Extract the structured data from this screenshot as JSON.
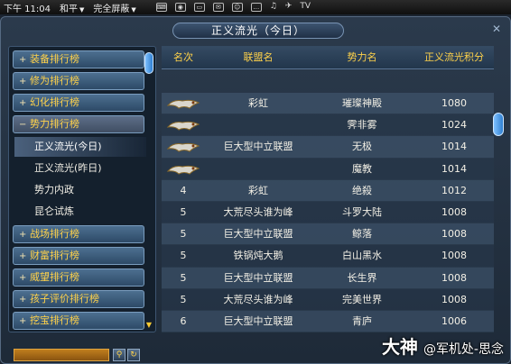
{
  "statusbar": {
    "time": "下午 11:04",
    "status": "和平",
    "display_mode": "完全屏蔽",
    "icons": [
      "keyboard-icon",
      "camera-icon",
      "monitor-icon",
      "mail-icon",
      "friends-icon",
      "chat-icon",
      "audio-icon",
      "bird-icon",
      "tv-icon"
    ],
    "tv_label": "TV"
  },
  "window": {
    "title": "正义流光（今日）"
  },
  "left_panel": {
    "categories_top": [
      {
        "label": "装备排行榜",
        "sign": "+"
      },
      {
        "label": "修为排行榜",
        "sign": "+"
      },
      {
        "label": "幻化排行榜",
        "sign": "+"
      },
      {
        "label": "势力排行榜",
        "sign": "−"
      }
    ],
    "subitems": [
      "正义流光(今日)",
      "正义流光(昨日)",
      "势力内政",
      "昆仑试炼"
    ],
    "categories_bottom": [
      {
        "label": "战场排行榜",
        "sign": "+"
      },
      {
        "label": "财富排行榜",
        "sign": "+"
      },
      {
        "label": "威望排行榜",
        "sign": "+"
      },
      {
        "label": "孩子评价排行榜",
        "sign": "+"
      },
      {
        "label": "挖宝排行榜",
        "sign": "+"
      }
    ]
  },
  "table": {
    "headers": {
      "rank": "名次",
      "union": "联盟名",
      "power": "势力名",
      "score": "正义流光积分"
    },
    "rows": [
      {
        "rank": "",
        "medal": true,
        "union": "彩虹",
        "power": "璀璨神殿",
        "score": "1080"
      },
      {
        "rank": "",
        "medal": true,
        "union": "",
        "power": "霁非雾",
        "score": "1024"
      },
      {
        "rank": "",
        "medal": true,
        "union": "巨大型中立联盟",
        "power": "无极",
        "score": "1014"
      },
      {
        "rank": "",
        "medal": true,
        "union": "",
        "power": "魔教",
        "score": "1014"
      },
      {
        "rank": "4",
        "medal": false,
        "union": "彩虹",
        "power": "绝殺",
        "score": "1012"
      },
      {
        "rank": "5",
        "medal": false,
        "union": "大荒尽头谁为峰",
        "power": "斗罗大陆",
        "score": "1008"
      },
      {
        "rank": "5",
        "medal": false,
        "union": "巨大型中立联盟",
        "power": "鲸落",
        "score": "1008"
      },
      {
        "rank": "5",
        "medal": false,
        "union": "铁锅炖大鹅",
        "power": "白山黑水",
        "score": "1008"
      },
      {
        "rank": "5",
        "medal": false,
        "union": "巨大型中立联盟",
        "power": "长生界",
        "score": "1008"
      },
      {
        "rank": "5",
        "medal": false,
        "union": "大荒尽头谁为峰",
        "power": "完美世界",
        "score": "1008"
      },
      {
        "rank": "6",
        "medal": false,
        "union": "巨大型中立联盟",
        "power": "青庐",
        "score": "1006"
      }
    ]
  },
  "watermark": {
    "brand": "大神",
    "handle": "@军机处-思念"
  },
  "colors": {
    "category_text": "#ffd24a",
    "header_text": "#ffd24a",
    "search_field": "#c07e1e"
  }
}
